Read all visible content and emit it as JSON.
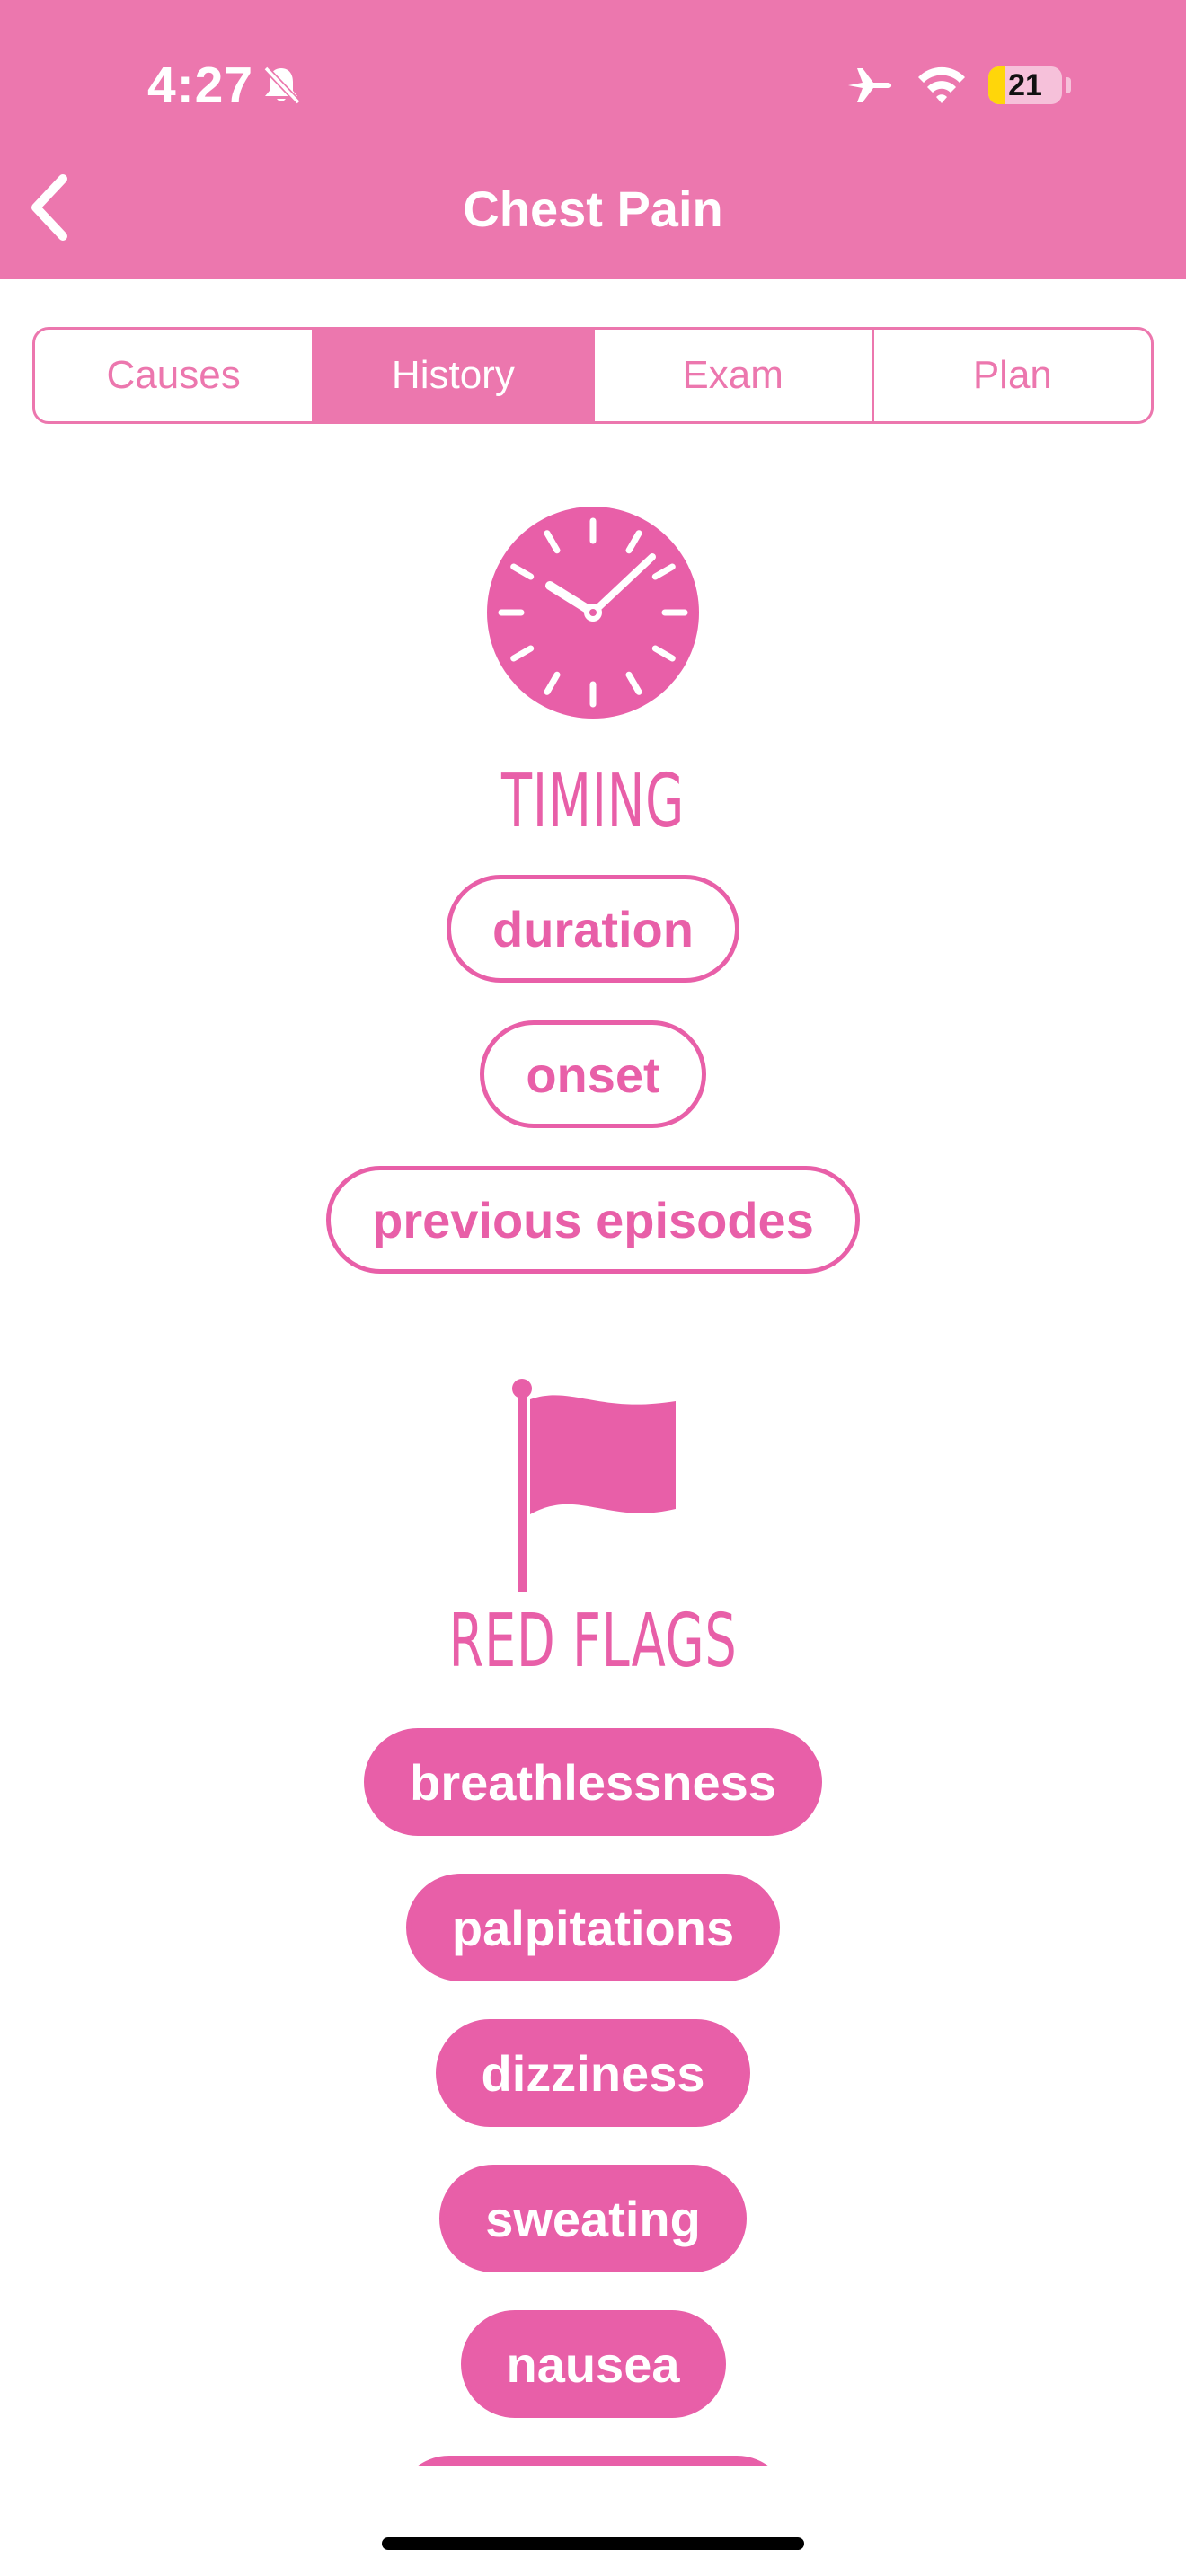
{
  "status_bar": {
    "time": "4:27",
    "battery_level": "21",
    "icons": [
      "bell-slash-icon",
      "airplane-icon",
      "wifi-icon",
      "battery-icon"
    ]
  },
  "nav": {
    "title": "Chest Pain",
    "back_icon": "chevron-left-icon"
  },
  "tabs": [
    {
      "label": "Causes",
      "active": false
    },
    {
      "label": "History",
      "active": true
    },
    {
      "label": "Exam",
      "active": false
    },
    {
      "label": "Plan",
      "active": false
    }
  ],
  "sections": [
    {
      "heading": "TIMING",
      "icon": "clock-icon",
      "items": [
        "duration",
        "onset",
        "previous episodes"
      ]
    },
    {
      "heading": "RED FLAGS",
      "icon": "flag-icon",
      "items": [
        "breathlessness",
        "palpitations",
        "dizziness",
        "sweating",
        "nausea",
        ""
      ]
    }
  ],
  "colors": {
    "header": "#ec77ae",
    "accent": "#e85fa8",
    "background": "#ffffff"
  }
}
